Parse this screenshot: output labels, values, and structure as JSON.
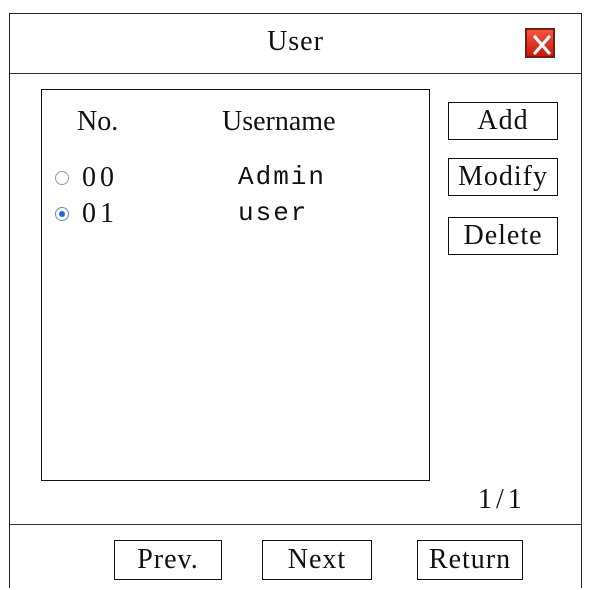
{
  "window": {
    "title": "User",
    "close_icon": "close-x-icon",
    "close_color": "#e0301e"
  },
  "list": {
    "headers": {
      "no": "No.",
      "username": "Username"
    },
    "rows": [
      {
        "no": "00",
        "username": "Admin",
        "selected": false
      },
      {
        "no": "01",
        "username": "user",
        "selected": true
      }
    ]
  },
  "actions": {
    "add": "Add",
    "modify": "Modify",
    "delete": "Delete"
  },
  "pagination": {
    "indicator": "1/1",
    "prev": "Prev.",
    "next": "Next",
    "return": "Return"
  },
  "colors": {
    "radio_selected": "#1b6ad8"
  }
}
